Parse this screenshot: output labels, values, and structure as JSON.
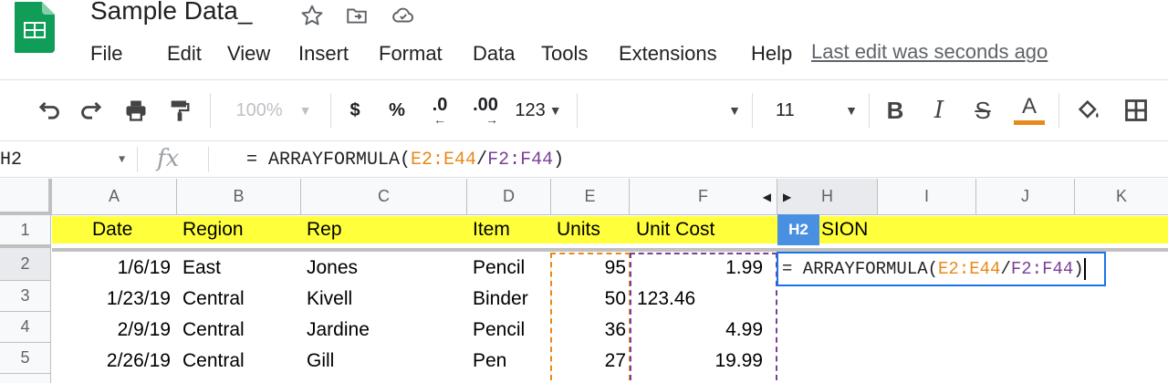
{
  "app": {
    "doc_title": "Sample Data_",
    "menu": [
      "File",
      "Edit",
      "View",
      "Insert",
      "Format",
      "Data",
      "Tools",
      "Extensions",
      "Help"
    ],
    "last_edit": "Last edit was seconds ago",
    "brand_color": "#0f9d58"
  },
  "toolbar": {
    "zoom": "100%",
    "currency": "$",
    "percent": "%",
    "dec_decrease": ".0",
    "dec_increase": ".00",
    "more_formats": "123",
    "font_size": "11",
    "bold": "B",
    "italic": "I",
    "strike": "S",
    "text_color": "A",
    "text_color_bar": "#e8891a"
  },
  "formula_bar": {
    "name_box": "H2",
    "fx": "fx",
    "formula_prefix": "= ARRAYFORMULA(",
    "range1": "E2:E44",
    "slash": "/",
    "range2": "F2:F44",
    "formula_suffix": ")"
  },
  "grid": {
    "columns": [
      "A",
      "B",
      "C",
      "D",
      "E",
      "F",
      "H",
      "I",
      "J",
      "K"
    ],
    "rows": [
      "1",
      "2",
      "3",
      "4",
      "5"
    ],
    "header_row": {
      "date": "Date",
      "region": "Region",
      "rep": "Rep",
      "item": "Item",
      "units": "Units",
      "unit_cost": "Unit Cost",
      "h_partial": "SION"
    },
    "cell_ref_tag": "H2",
    "data": [
      {
        "date": "1/6/19",
        "region": "East",
        "rep": "Jones",
        "item": "Pencil",
        "units": "95",
        "unit_cost": "1.99"
      },
      {
        "date": "1/23/19",
        "region": "Central",
        "rep": "Kivell",
        "item": "Binder",
        "units": "50",
        "unit_cost": "123.46"
      },
      {
        "date": "2/9/19",
        "region": "Central",
        "rep": "Jardine",
        "item": "Pencil",
        "units": "36",
        "unit_cost": "4.99"
      },
      {
        "date": "2/26/19",
        "region": "Central",
        "rep": "Gill",
        "item": "Pen",
        "units": "27",
        "unit_cost": "19.99"
      }
    ],
    "header_fill": "#ffff3b",
    "active_border": "#1a73e8"
  }
}
